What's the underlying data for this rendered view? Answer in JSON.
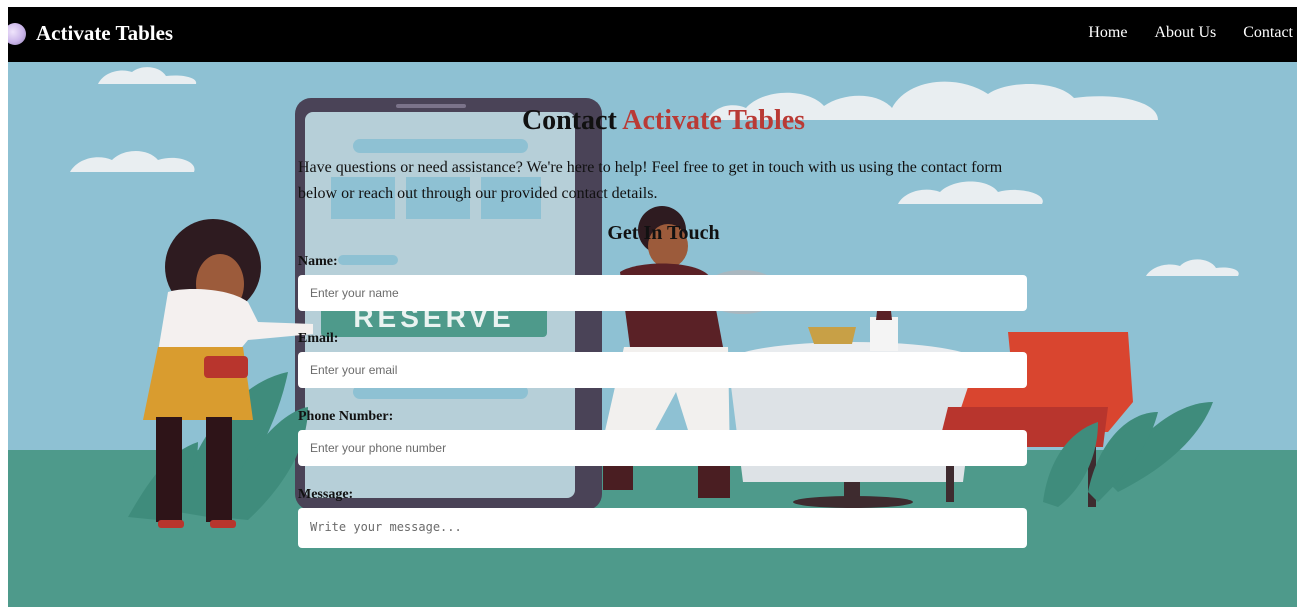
{
  "navbar": {
    "brand": "Activate Tables",
    "links": [
      "Home",
      "About Us",
      "Contact"
    ]
  },
  "hero": {
    "reserve_sign": "RESERVE"
  },
  "contact": {
    "title_prefix": "Contact",
    "title_accent": "Activate Tables",
    "intro": "Have questions or need assistance? We're here to help! Feel free to get in touch with us using the contact form below or reach out through our provided contact details.",
    "form_heading": "Get In Touch",
    "fields": {
      "name": {
        "label": "Name:",
        "placeholder": "Enter your name"
      },
      "email": {
        "label": "Email:",
        "placeholder": "Enter your email"
      },
      "phone": {
        "label": "Phone Number:",
        "placeholder": "Enter your phone number"
      },
      "message": {
        "label": "Message:",
        "placeholder": "Write your message..."
      }
    }
  },
  "colors": {
    "navbar_bg": "#000000",
    "sky": "#8ec1d3",
    "ground": "#4e9a8b",
    "accent": "#b93a35"
  }
}
